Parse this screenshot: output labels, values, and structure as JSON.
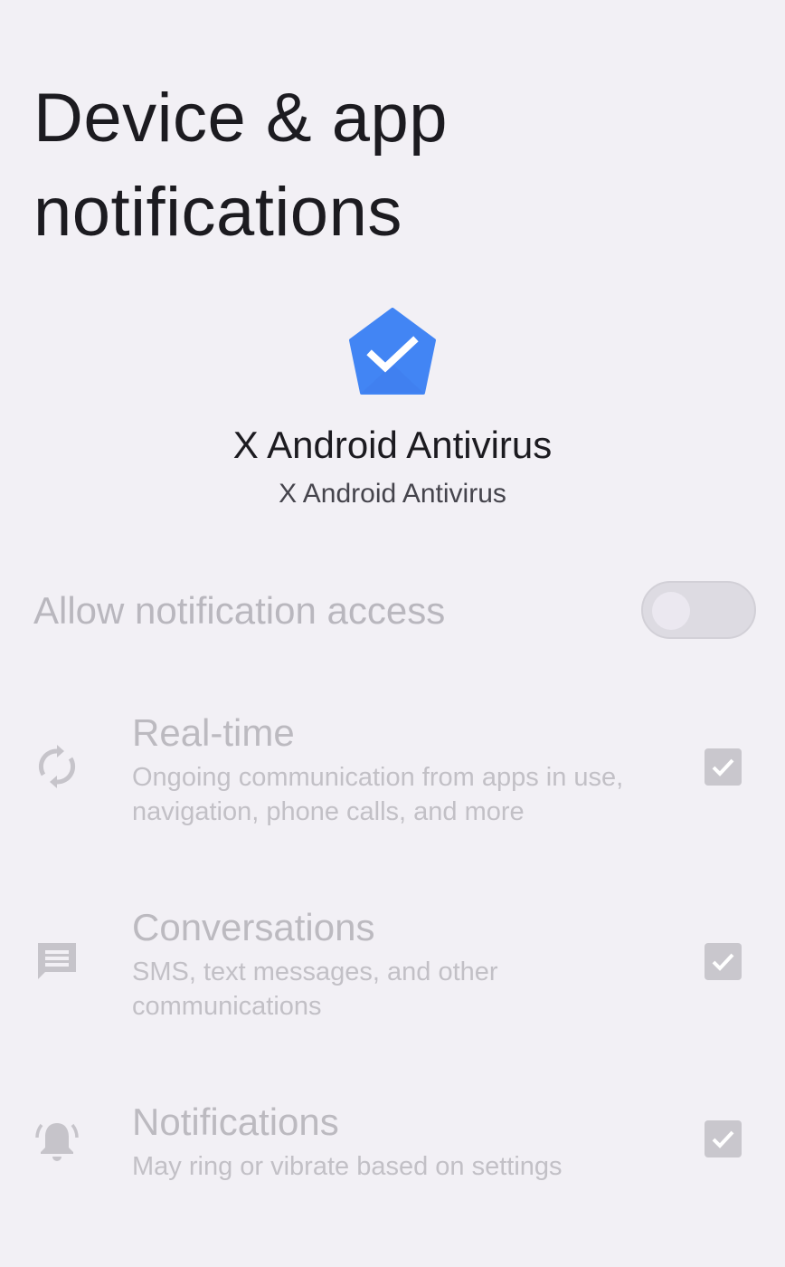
{
  "page": {
    "title": "Device & app notifications"
  },
  "app": {
    "icon": "verified-shield-icon",
    "name": "X Android Antivirus",
    "package_label": "X Android Antivirus",
    "icon_color": "#4285f4"
  },
  "access": {
    "label": "Allow notification access",
    "enabled": false
  },
  "notification_types": [
    {
      "icon": "sync-icon",
      "title": "Real-time",
      "description": "Ongoing communication from apps in use, navigation, phone calls, and more",
      "checked": true
    },
    {
      "icon": "message-icon",
      "title": "Conversations",
      "description": "SMS, text messages, and other communications",
      "checked": true
    },
    {
      "icon": "bell-ringing-icon",
      "title": "Notifications",
      "description": "May ring or vibrate based on settings",
      "checked": true
    }
  ],
  "colors": {
    "background": "#f2f0f5",
    "disabled_text": "#bcbac0",
    "checkbox_disabled": "#c9c7cd"
  }
}
